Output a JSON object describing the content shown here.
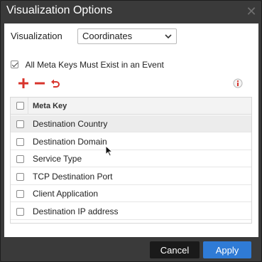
{
  "dialog": {
    "title": "Visualization Options"
  },
  "form": {
    "visualization_label": "Visualization",
    "visualization_value": "Coordinates",
    "all_meta_keys_label": "All Meta Keys Must Exist in an Event",
    "all_meta_keys_checked": true
  },
  "grid": {
    "header": "Meta Key",
    "rows": [
      {
        "label": "Destination Country",
        "checked": false
      },
      {
        "label": "Destination Domain",
        "checked": false
      },
      {
        "label": "Service Type",
        "checked": false
      },
      {
        "label": "TCP Destination Port",
        "checked": false
      },
      {
        "label": "Client Application",
        "checked": false
      },
      {
        "label": "Destination IP address",
        "checked": false
      }
    ],
    "hovered_row": 0
  },
  "buttons": {
    "cancel_label": "Cancel",
    "apply_label": "Apply"
  },
  "icons": {
    "close": "close-icon",
    "add": "plus-icon",
    "remove": "minus-icon",
    "undo": "undo-icon",
    "info": "info-icon",
    "dropdown": "chevron-down-icon",
    "pointer": "mouse-cursor-icon"
  },
  "colors": {
    "title_bar": "#3a3a3a",
    "accent_red": "#d8342c",
    "apply_button": "#2f7bd6",
    "cancel_button": "#1a1a1a",
    "hover_row": "#ececec"
  }
}
